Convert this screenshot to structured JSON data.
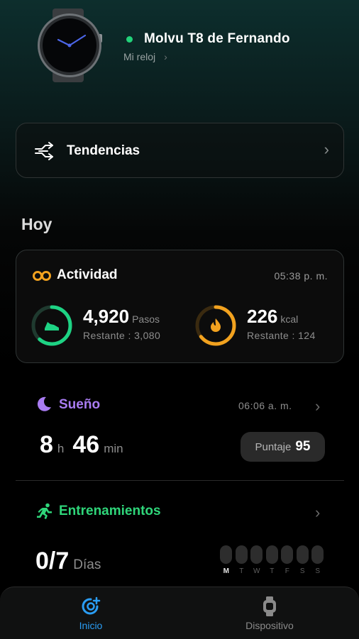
{
  "device": {
    "name": "Molvu T8 de Fernando",
    "subtitle": "Mi reloj",
    "status_color": "#22d27a"
  },
  "trends": {
    "label": "Tendencias"
  },
  "section_title": "Hoy",
  "activity": {
    "title": "Actividad",
    "time": "05:38 p. m.",
    "steps": {
      "value": "4,920",
      "unit": "Pasos",
      "remaining": "Restante : 3,080",
      "progress": 0.615,
      "color": "#1ed384"
    },
    "calories": {
      "value": "226",
      "unit": "kcal",
      "remaining": "Restante : 124",
      "progress": 0.646,
      "color": "#f2a21f"
    }
  },
  "sleep": {
    "title": "Sueño",
    "time": "06:06 a. m.",
    "hours": "8",
    "hours_unit": "h",
    "minutes": "46",
    "minutes_unit": "min",
    "score_label": "Puntaje",
    "score_value": "95",
    "color": "#a97cf2"
  },
  "workouts": {
    "title": "Entrenamientos",
    "value": "0/7",
    "unit": "Días",
    "color": "#2fd67a",
    "days": [
      "M",
      "T",
      "W",
      "T",
      "F",
      "S",
      "S"
    ],
    "current_day_index": 0
  },
  "nav": {
    "items": [
      {
        "label": "Inicio",
        "active": true,
        "icon": "home-icon"
      },
      {
        "label": "Dispositivo",
        "active": false,
        "icon": "watch-icon"
      }
    ],
    "active_color": "#2a9df4",
    "inactive_color": "#8a8a8a"
  }
}
